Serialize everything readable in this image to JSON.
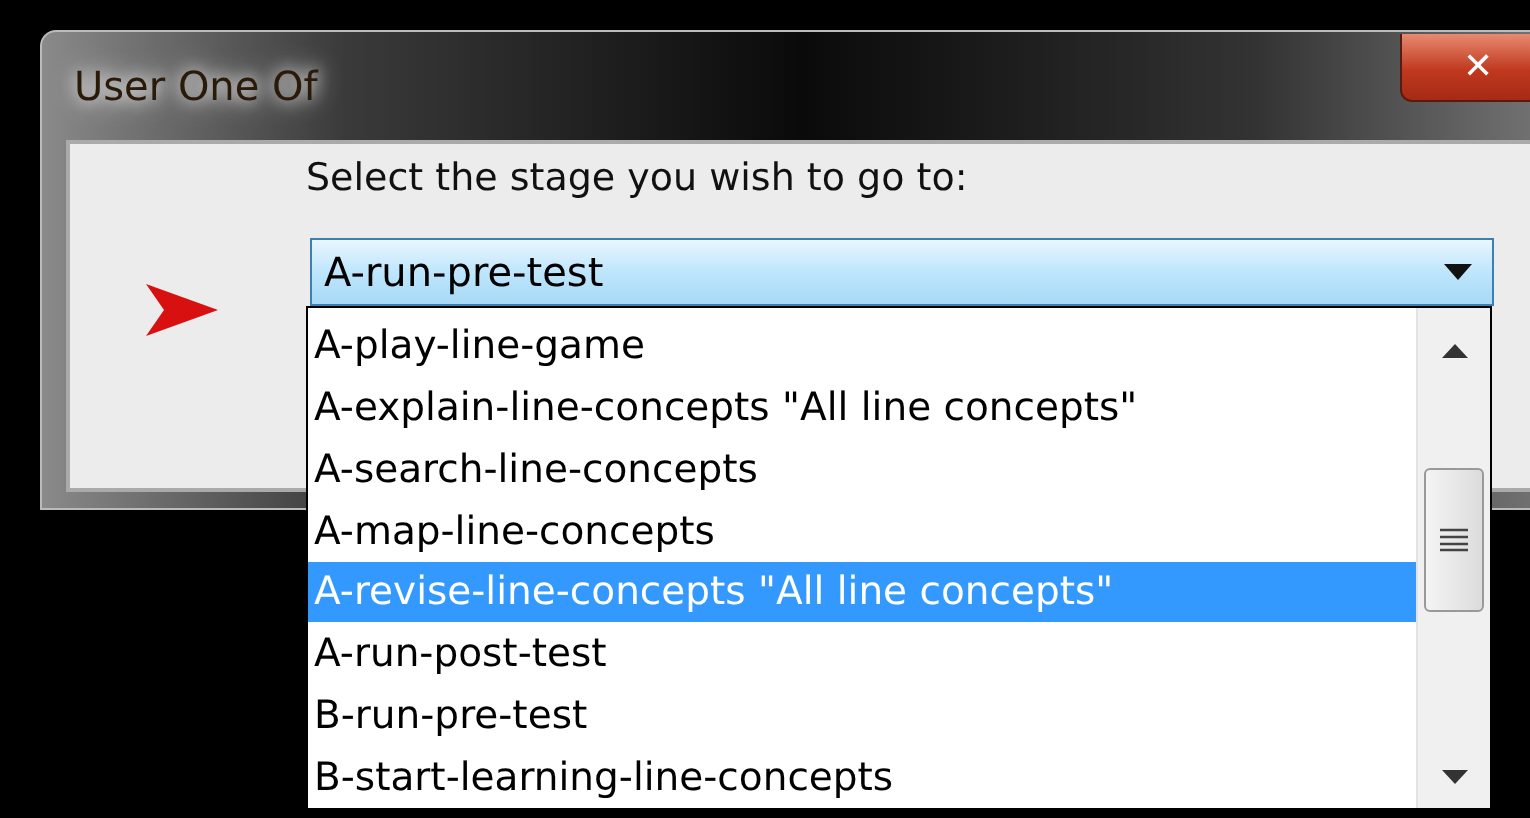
{
  "window": {
    "title": "User One Of",
    "close_glyph": "✕"
  },
  "prompt": "Select the stage you wish to go to:",
  "combo": {
    "value": "A-run-pre-test",
    "expanded": true
  },
  "options": [
    {
      "label": "A-play-line-game",
      "selected": false
    },
    {
      "label": "A-explain-line-concepts \"All line concepts\"",
      "selected": false
    },
    {
      "label": "A-search-line-concepts",
      "selected": false
    },
    {
      "label": "A-map-line-concepts",
      "selected": false
    },
    {
      "label": "A-revise-line-concepts \"All line concepts\"",
      "selected": true
    },
    {
      "label": "A-run-post-test",
      "selected": false
    },
    {
      "label": "B-run-pre-test",
      "selected": false
    },
    {
      "label": "B-start-learning-line-concepts",
      "selected": false
    }
  ]
}
